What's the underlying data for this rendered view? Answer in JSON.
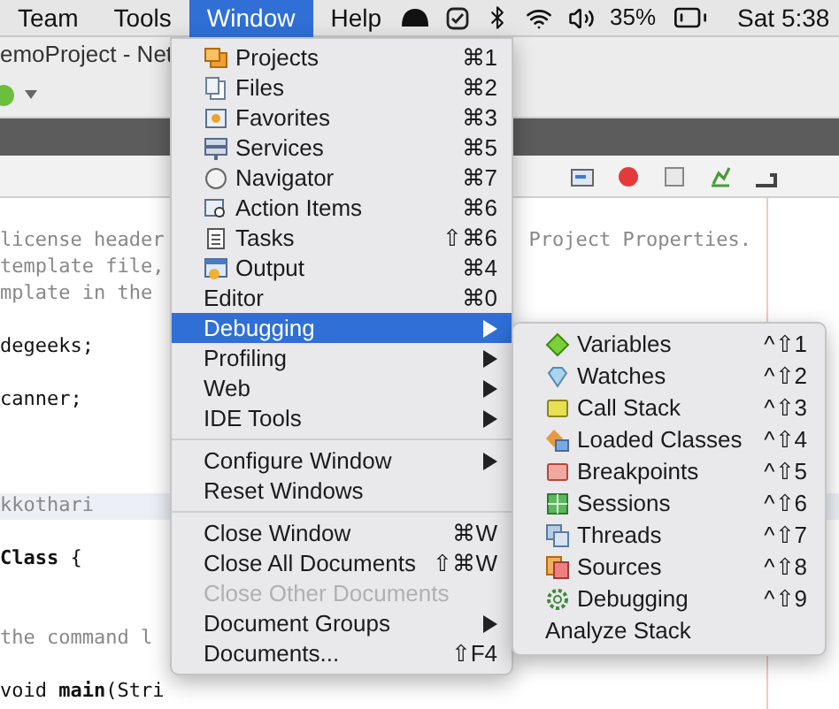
{
  "menu_bar": {
    "items": [
      {
        "label": "Team",
        "selected": false
      },
      {
        "label": "Tools",
        "selected": false
      },
      {
        "label": "Window",
        "selected": true
      },
      {
        "label": "Help",
        "selected": false
      }
    ],
    "battery": "35%",
    "clock": "Sat 5:38"
  },
  "ide": {
    "title": "emoProject - Net",
    "code_lines": [
      {
        "text": "license header",
        "kind": "comment",
        "tail": "Project Properties."
      },
      {
        "text": "template file,",
        "kind": "comment"
      },
      {
        "text": "mplate in the",
        "kind": "comment"
      },
      {
        "text": "degeeks;",
        "kind": "code"
      },
      {
        "text": "canner;",
        "kind": "code"
      },
      {
        "text": "kkothari",
        "kind": "highlight"
      },
      {
        "text": "**Class** {",
        "kind": "code"
      },
      {
        "text": "the command l",
        "kind": "comment"
      },
      {
        "text": "void **main**(Stri",
        "kind": "code"
      }
    ]
  },
  "window_menu": {
    "items": [
      {
        "kind": "item",
        "label": "Projects",
        "shortcut": "⌘1",
        "selected": false,
        "disabled": false
      },
      {
        "kind": "item",
        "label": "Files",
        "shortcut": "⌘2",
        "selected": false,
        "disabled": false
      },
      {
        "kind": "item",
        "label": "Favorites",
        "shortcut": "⌘3",
        "selected": false,
        "disabled": false
      },
      {
        "kind": "item",
        "label": "Services",
        "shortcut": "⌘5",
        "selected": false,
        "disabled": false
      },
      {
        "kind": "item",
        "label": "Navigator",
        "shortcut": "⌘7",
        "selected": false,
        "disabled": false
      },
      {
        "kind": "item",
        "label": "Action Items",
        "shortcut": "⌘6",
        "selected": false,
        "disabled": false
      },
      {
        "kind": "item",
        "label": "Tasks",
        "shortcut": "⇧⌘6",
        "selected": false,
        "disabled": false
      },
      {
        "kind": "item",
        "label": "Output",
        "shortcut": "⌘4",
        "selected": false,
        "disabled": false
      },
      {
        "kind": "item",
        "label": "Editor",
        "shortcut": "⌘0",
        "selected": false,
        "disabled": false
      },
      {
        "kind": "submenu",
        "label": "Debugging",
        "selected": true,
        "disabled": false
      },
      {
        "kind": "submenu",
        "label": "Profiling",
        "selected": false,
        "disabled": false
      },
      {
        "kind": "submenu",
        "label": "Web",
        "selected": false,
        "disabled": false
      },
      {
        "kind": "submenu",
        "label": "IDE Tools",
        "selected": false,
        "disabled": false
      },
      {
        "kind": "separator"
      },
      {
        "kind": "submenu",
        "label": "Configure Window",
        "selected": false,
        "disabled": false
      },
      {
        "kind": "item",
        "label": "Reset Windows",
        "selected": false,
        "disabled": false
      },
      {
        "kind": "separator"
      },
      {
        "kind": "item",
        "label": "Close Window",
        "shortcut": "⌘W",
        "selected": false,
        "disabled": false
      },
      {
        "kind": "item",
        "label": "Close All Documents",
        "shortcut": "⇧⌘W",
        "selected": false,
        "disabled": false
      },
      {
        "kind": "item",
        "label": "Close Other Documents",
        "selected": false,
        "disabled": true
      },
      {
        "kind": "submenu",
        "label": "Document Groups",
        "selected": false,
        "disabled": false
      },
      {
        "kind": "item",
        "label": "Documents...",
        "shortcut": "⇧F4",
        "selected": false,
        "disabled": false
      }
    ]
  },
  "debugging_submenu": {
    "items": [
      {
        "label": "Variables",
        "shortcut": "^⇧1"
      },
      {
        "label": "Watches",
        "shortcut": "^⇧2"
      },
      {
        "label": "Call Stack",
        "shortcut": "^⇧3"
      },
      {
        "label": "Loaded Classes",
        "shortcut": "^⇧4"
      },
      {
        "label": "Breakpoints",
        "shortcut": "^⇧5"
      },
      {
        "label": "Sessions",
        "shortcut": "^⇧6"
      },
      {
        "label": "Threads",
        "shortcut": "^⇧7"
      },
      {
        "label": "Sources",
        "shortcut": "^⇧8"
      },
      {
        "label": "Debugging",
        "shortcut": "^⇧9"
      },
      {
        "label": "Analyze Stack"
      }
    ]
  }
}
